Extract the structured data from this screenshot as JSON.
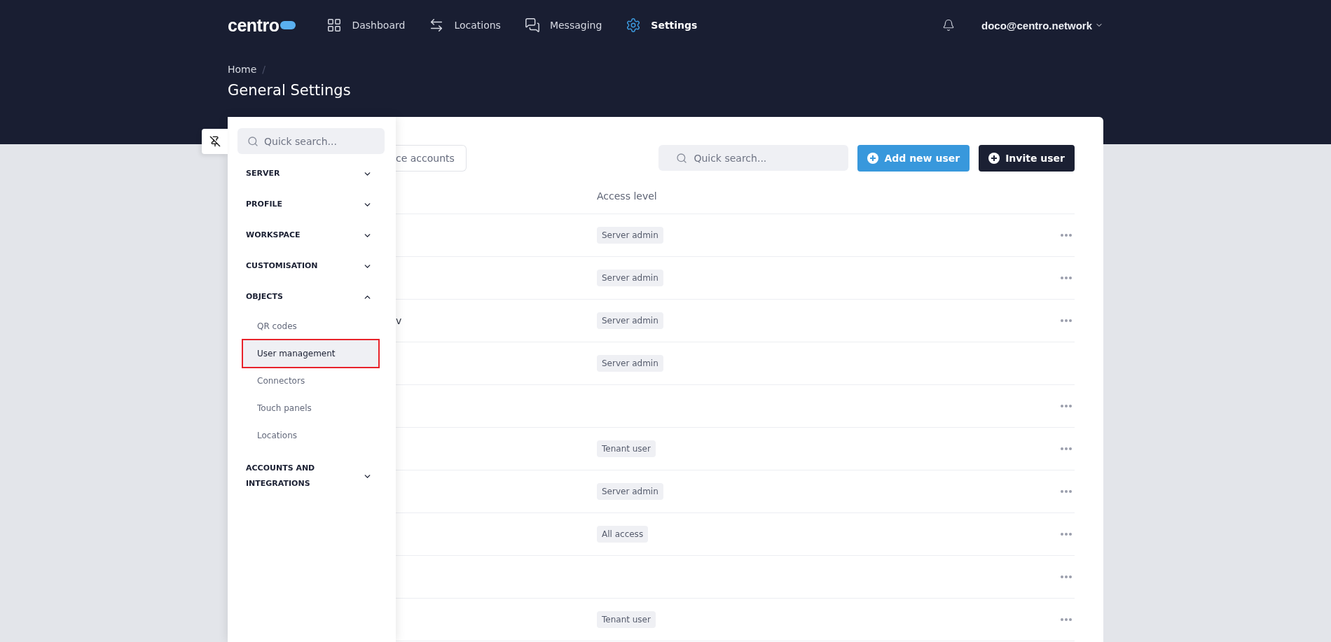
{
  "header": {
    "logo": "centro",
    "nav": [
      {
        "label": "Dashboard",
        "selected": false
      },
      {
        "label": "Locations",
        "selected": false
      },
      {
        "label": "Messaging",
        "selected": false
      },
      {
        "label": "Settings",
        "selected": true
      }
    ],
    "user": "doco@centro.network"
  },
  "breadcrumb": [
    {
      "label": "Home",
      "separator": "/"
    }
  ],
  "page_title": "General Settings",
  "sidebar": {
    "search": {
      "placeholder": "Quick search..."
    },
    "sections": [
      {
        "label": "SERVER",
        "expanded": false
      },
      {
        "label": "PROFILE",
        "expanded": false
      },
      {
        "label": "WORKSPACE",
        "expanded": false
      },
      {
        "label": "CUSTOMISATION",
        "expanded": false
      },
      {
        "label": "OBJECTS",
        "expanded": true,
        "children": [
          {
            "label": "QR codes",
            "selected": false,
            "annotated": false
          },
          {
            "label": "User management",
            "selected": true,
            "annotated": true
          },
          {
            "label": "Connectors",
            "selected": false,
            "annotated": false
          },
          {
            "label": "Touch panels",
            "selected": false,
            "annotated": false
          },
          {
            "label": "Locations",
            "selected": false,
            "annotated": false
          }
        ]
      },
      {
        "label": "ACCOUNTS AND INTEGRATIONS",
        "expanded": false
      }
    ]
  },
  "toolbar": {
    "tab": "ce accounts",
    "search": {
      "placeholder": "Quick search..."
    },
    "buttons": [
      {
        "label": "Add new user",
        "kind": "primary"
      },
      {
        "label": "Invite user",
        "kind": "dark"
      }
    ]
  },
  "table": {
    "columns": [
      "Access level"
    ],
    "rows": [
      {
        "name": "",
        "access": "Server admin",
        "menu": true
      },
      {
        "name": "",
        "access": "Server admin",
        "menu": true
      },
      {
        "name": "v",
        "access": "Server admin",
        "menu": true
      },
      {
        "name": "",
        "access": "Server admin",
        "menu": false
      },
      {
        "name": "",
        "access": "",
        "menu": true
      },
      {
        "name": "",
        "access": "Tenant user",
        "menu": true
      },
      {
        "name": "",
        "access": "Server admin",
        "menu": true
      },
      {
        "name": "",
        "access": "All access",
        "menu": true
      },
      {
        "name": "",
        "access": "",
        "menu": true
      },
      {
        "name": "",
        "access": "Tenant user",
        "menu": true
      }
    ]
  }
}
